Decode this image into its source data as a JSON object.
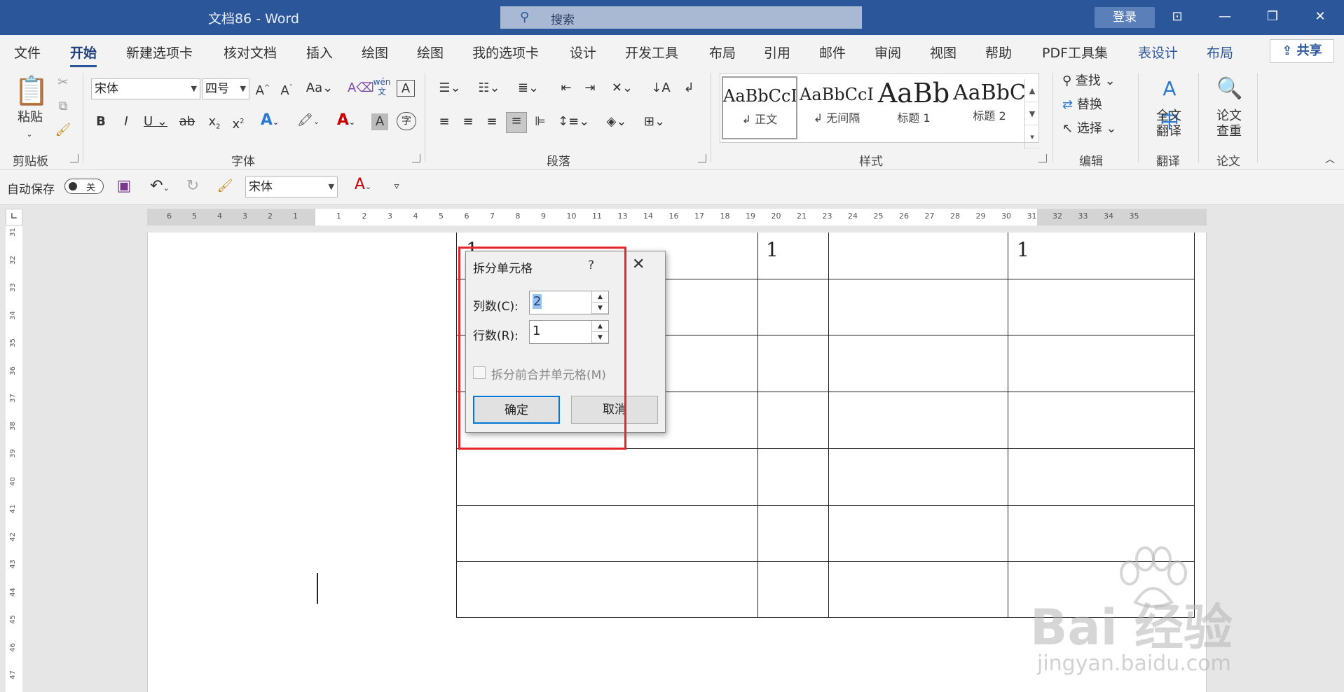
{
  "titlebar": {
    "title": "文档86  -  Word",
    "search_placeholder": "搜索",
    "login": "登录"
  },
  "menu": {
    "tabs": [
      "文件",
      "开始",
      "新建选项卡",
      "核对文档",
      "插入",
      "绘图",
      "绘图",
      "我的选项卡",
      "设计",
      "开发工具",
      "布局",
      "引用",
      "邮件",
      "审阅",
      "视图",
      "帮助",
      "PDF工具集",
      "表设计",
      "布局"
    ],
    "active": "开始",
    "share": "共享"
  },
  "ribbon": {
    "clipboard": {
      "label": "剪贴板",
      "paste": "粘贴"
    },
    "font": {
      "label": "字体",
      "family": "宋体",
      "size": "四号",
      "wen_top": "wén",
      "wen_bottom": "文"
    },
    "paragraph": {
      "label": "段落"
    },
    "styles": {
      "label": "样式",
      "items": [
        {
          "sample": "AaBbCcI",
          "name": "↲ 正文"
        },
        {
          "sample": "AaBbCcI",
          "name": "↲ 无间隔"
        },
        {
          "sample": "AaBb",
          "name": "标题 1"
        },
        {
          "sample": "AaBbC",
          "name": "标题 2"
        }
      ]
    },
    "editing": {
      "label": "编辑",
      "find": "查找",
      "replace": "替换",
      "select": "选择"
    },
    "translate": {
      "label": "翻译",
      "full": "全文",
      "full2": "翻译"
    },
    "paper": {
      "label": "论文",
      "check": "论文",
      "check2": "查重"
    }
  },
  "qat": {
    "autosave": "自动保存",
    "toggle_state": "关",
    "font": "宋体"
  },
  "document": {
    "cell_values": [
      "1",
      "1",
      "1"
    ]
  },
  "dialog": {
    "title": "拆分单元格",
    "help": "?",
    "cols_label": "列数(C):",
    "cols_value": "2",
    "rows_label": "行数(R):",
    "rows_value": "1",
    "merge_label": "拆分前合并单元格(M)",
    "ok": "确定",
    "cancel": "取消"
  },
  "watermark": {
    "brand": "Bai 经验",
    "url": "jingyan.baidu.com"
  },
  "colors": {
    "accent": "#2b579a",
    "highlight_box": "#e6262a"
  }
}
